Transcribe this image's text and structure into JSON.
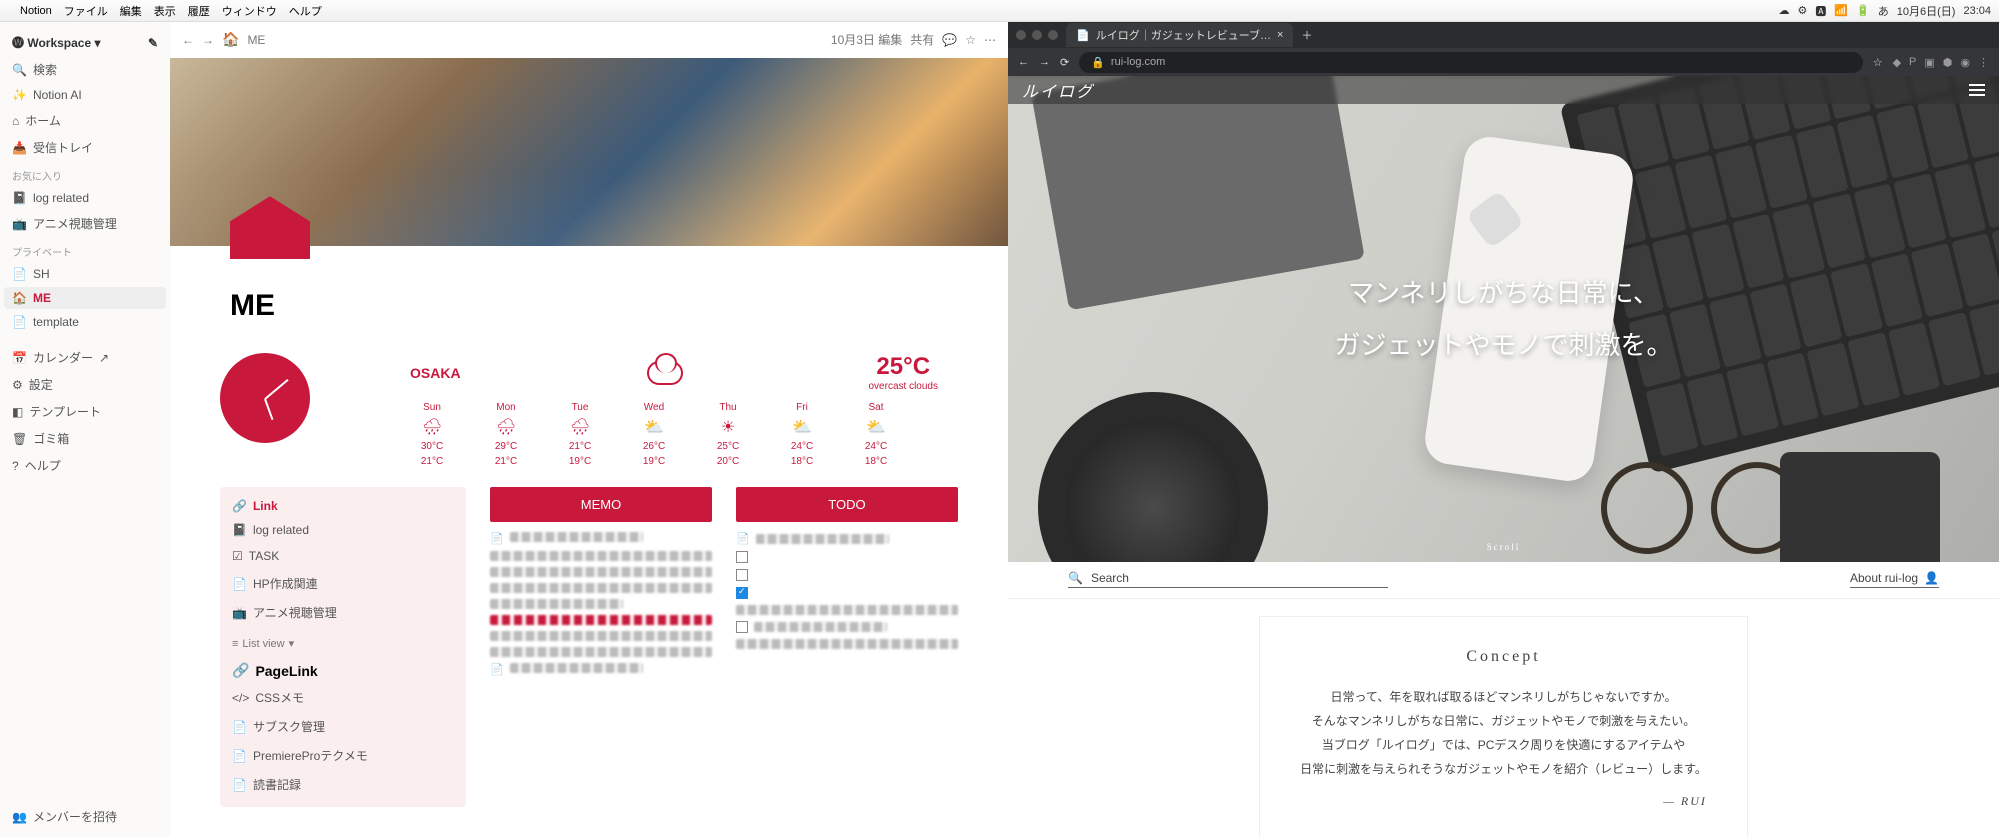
{
  "menubar": {
    "app": "Notion",
    "items": [
      "ファイル",
      "編集",
      "表示",
      "履歴",
      "ウィンドウ",
      "ヘルプ"
    ],
    "date": "10月6日(日)",
    "time": "23:04"
  },
  "notion": {
    "workspace": "Workspace",
    "nav": {
      "search": "検索",
      "ai": "Notion AI",
      "home": "ホーム",
      "inbox": "受信トレイ"
    },
    "sections": {
      "favorites": "お気に入り",
      "private": "プライベート"
    },
    "fav_items": [
      "log related",
      "アニメ視聴管理"
    ],
    "priv_items": [
      "SH",
      "ME",
      "template"
    ],
    "bottom": {
      "calendar": "カレンダー",
      "settings": "設定",
      "templates": "テンプレート",
      "trash": "ゴミ箱",
      "help": "ヘルプ",
      "invite": "メンバーを招待"
    },
    "breadcrumb": "ME",
    "header_meta": "10月3日 編集",
    "share": "共有",
    "page_title": "ME",
    "weather": {
      "city": "OSAKA",
      "temp": "25°C",
      "cond": "overcast clouds",
      "days": [
        {
          "d": "Sun",
          "ico": "🌧",
          "hi": "30°C",
          "lo": "21°C"
        },
        {
          "d": "Mon",
          "ico": "🌧",
          "hi": "29°C",
          "lo": "21°C"
        },
        {
          "d": "Tue",
          "ico": "🌧",
          "hi": "21°C",
          "lo": "19°C"
        },
        {
          "d": "Wed",
          "ico": "⛅",
          "hi": "26°C",
          "lo": "19°C"
        },
        {
          "d": "Thu",
          "ico": "☀",
          "hi": "25°C",
          "lo": "20°C"
        },
        {
          "d": "Fri",
          "ico": "⛅",
          "hi": "24°C",
          "lo": "18°C"
        },
        {
          "d": "Sat",
          "ico": "⛅",
          "hi": "24°C",
          "lo": "18°C"
        }
      ]
    },
    "link_block": {
      "title": "Link",
      "items": [
        "log related",
        "TASK",
        "HP作成関連",
        "アニメ視聴管理"
      ],
      "listview": "List view",
      "pagelink": "PageLink",
      "pages": [
        "CSSメモ",
        "サブスク管理",
        "PremiereProテクメモ",
        "読書記録"
      ]
    },
    "memo_title": "MEMO",
    "todo_title": "TODO"
  },
  "browser": {
    "tab_title": "ルイログ｜ガジェットレビューブ…",
    "url": "rui-log.com",
    "site_name": "ルイログ",
    "hero_line1": "マンネリしがちな日常に、",
    "hero_line2": "ガジェットやモノで刺激を。",
    "scroll": "Scroll",
    "search_label": "Search",
    "about_label": "About rui-log",
    "concept_title": "Concept",
    "concept_lines": [
      "日常って、年を取れば取るほどマンネリしがちじゃないですか。",
      "そんなマンネリしがちな日常に、ガジェットやモノで刺激を与えたい。",
      "当ブログ「ルイログ」では、PCデスク周りを快適にするアイテムや",
      "日常に刺激を与えられそうなガジェットやモノを紹介（レビュー）します。"
    ],
    "signature": "— RUI"
  }
}
